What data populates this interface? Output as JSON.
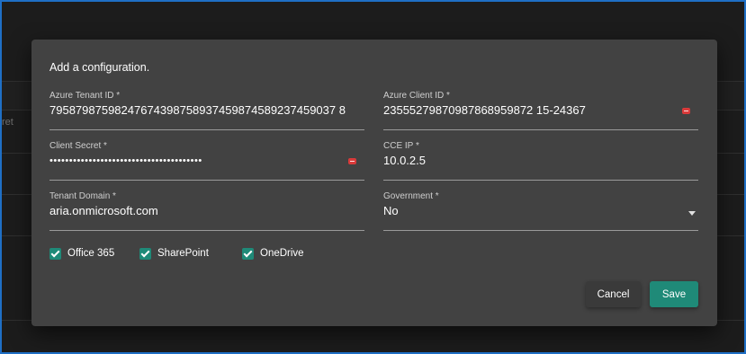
{
  "background": {
    "partial_text": "ret"
  },
  "dialog": {
    "title": "Add a configuration.",
    "fields": {
      "azure_tenant_id": {
        "label": "Azure Tenant ID *",
        "value": "79587987598247674398758937459874589237459037 8"
      },
      "azure_client_id": {
        "label": "Azure Client ID *",
        "value": "23555279870987868959872 15-24367"
      },
      "client_secret": {
        "label": "Client Secret *",
        "value": "•••••••••••••••••••••••••••••••••••••••"
      },
      "cce_ip": {
        "label": "CCE IP *",
        "value": "10.0.2.5"
      },
      "tenant_domain": {
        "label": "Tenant Domain *",
        "value": "aria.onmicrosoft.com"
      },
      "government": {
        "label": "Government *",
        "value": "No"
      }
    },
    "checkboxes": [
      {
        "label": "Office 365",
        "checked": true
      },
      {
        "label": "SharePoint",
        "checked": true
      },
      {
        "label": "OneDrive",
        "checked": true
      }
    ],
    "buttons": {
      "cancel": "Cancel",
      "save": "Save"
    }
  },
  "colors": {
    "accent": "#1f8a78",
    "dialog_bg": "#424242",
    "page_bg": "#1c1c1c",
    "frame_border": "#1f6fc5",
    "reveal_icon": "#d93a3a"
  },
  "icons": {
    "reveal_secret": "eye-reveal-icon",
    "reveal_client_id": "eye-reveal-icon",
    "government_dropdown": "chevron-down-icon"
  }
}
